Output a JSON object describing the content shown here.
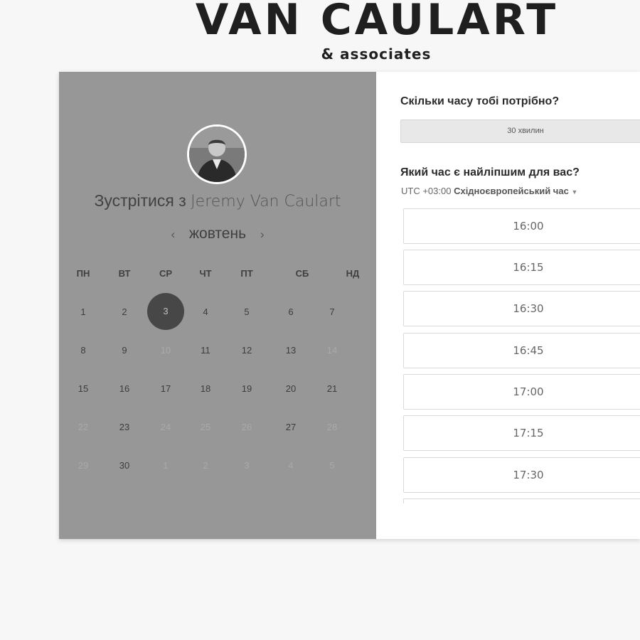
{
  "brand": {
    "name": "VAN CAULART",
    "sub": "& associates"
  },
  "left": {
    "meet_prefix": "Зустрітися з",
    "meet_name": "Jeremy Van Caulart",
    "month": "жовтень",
    "prev_icon": "chevron-left-icon",
    "next_icon": "chevron-right-icon",
    "weekdays": [
      "ПН",
      "ВТ",
      "СР",
      "ЧТ",
      "ПТ",
      "СБ",
      "НД"
    ],
    "weeks": [
      [
        "1",
        "2",
        "3",
        "4",
        "5",
        "6",
        "7"
      ],
      [
        "8",
        "9",
        "10",
        "11",
        "12",
        "13",
        "14"
      ],
      [
        "15",
        "16",
        "17",
        "18",
        "19",
        "20",
        "21"
      ],
      [
        "22",
        "23",
        "24",
        "25",
        "26",
        "27",
        "28"
      ],
      [
        "29",
        "30",
        "1",
        "2",
        "3",
        "4",
        "5"
      ]
    ],
    "selected": "3"
  },
  "right": {
    "duration_question": "Скільки часу тобі потрібно?",
    "duration_value": "30 хвилин",
    "time_question": "Який час є найліпшим для вас?",
    "tz_offset": "UTC +03:00",
    "tz_name": "Східноєвропейський час",
    "tz_icon": "caret-down-icon",
    "slots": [
      "16:00",
      "16:15",
      "16:30",
      "16:45",
      "17:00",
      "17:15",
      "17:30"
    ]
  }
}
